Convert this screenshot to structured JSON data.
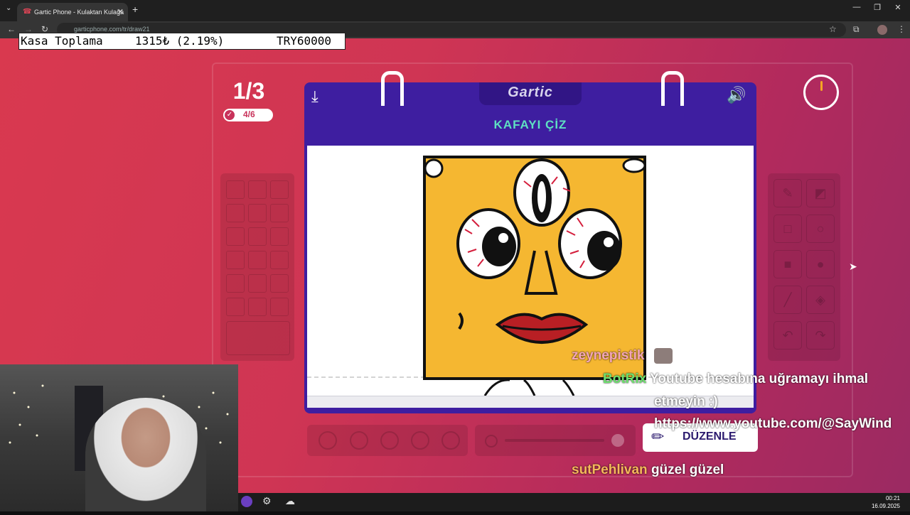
{
  "browser": {
    "tab_title": "Gartic Phone - Kulaktan Kulağa",
    "new_tab": "+",
    "url": "garticphone.com/tr/draw21",
    "window_controls": [
      "—",
      "❐",
      "✕"
    ]
  },
  "ticker": {
    "label": "Kasa Toplama",
    "amount": "1315₺ (2.19%)",
    "goal": "TRY60000"
  },
  "game": {
    "round": "1/3",
    "progress": "4/6",
    "logo": "Gartic",
    "instruction": "KAFAYI ÇİZ",
    "edit_button": "DÜZENLE",
    "timer_icon": "timer-icon",
    "colors": {
      "card": "#3e1ea0",
      "instruction": "#5ee0c2",
      "background": "#d9394f"
    }
  },
  "chat": {
    "messages": [
      {
        "name": "zeynepistik",
        "name_color": "#f4a6b8",
        "text": ""
      },
      {
        "name": "BotRix",
        "name_color": "#6ee06e",
        "text": "Youtube hesabına uğramayı ihmal"
      },
      {
        "name": "",
        "name_color": "#ffffff",
        "text": "etmeyin :)"
      },
      {
        "name": "",
        "name_color": "#ffffff",
        "text": "https://www.youtube.com/@SayWind"
      },
      {
        "name": "sutPehlivan",
        "name_color": "#f5b85a",
        "text": "güzel güzel"
      }
    ]
  },
  "taskbar": {
    "time": "00:21",
    "date": "16.09.2025"
  }
}
